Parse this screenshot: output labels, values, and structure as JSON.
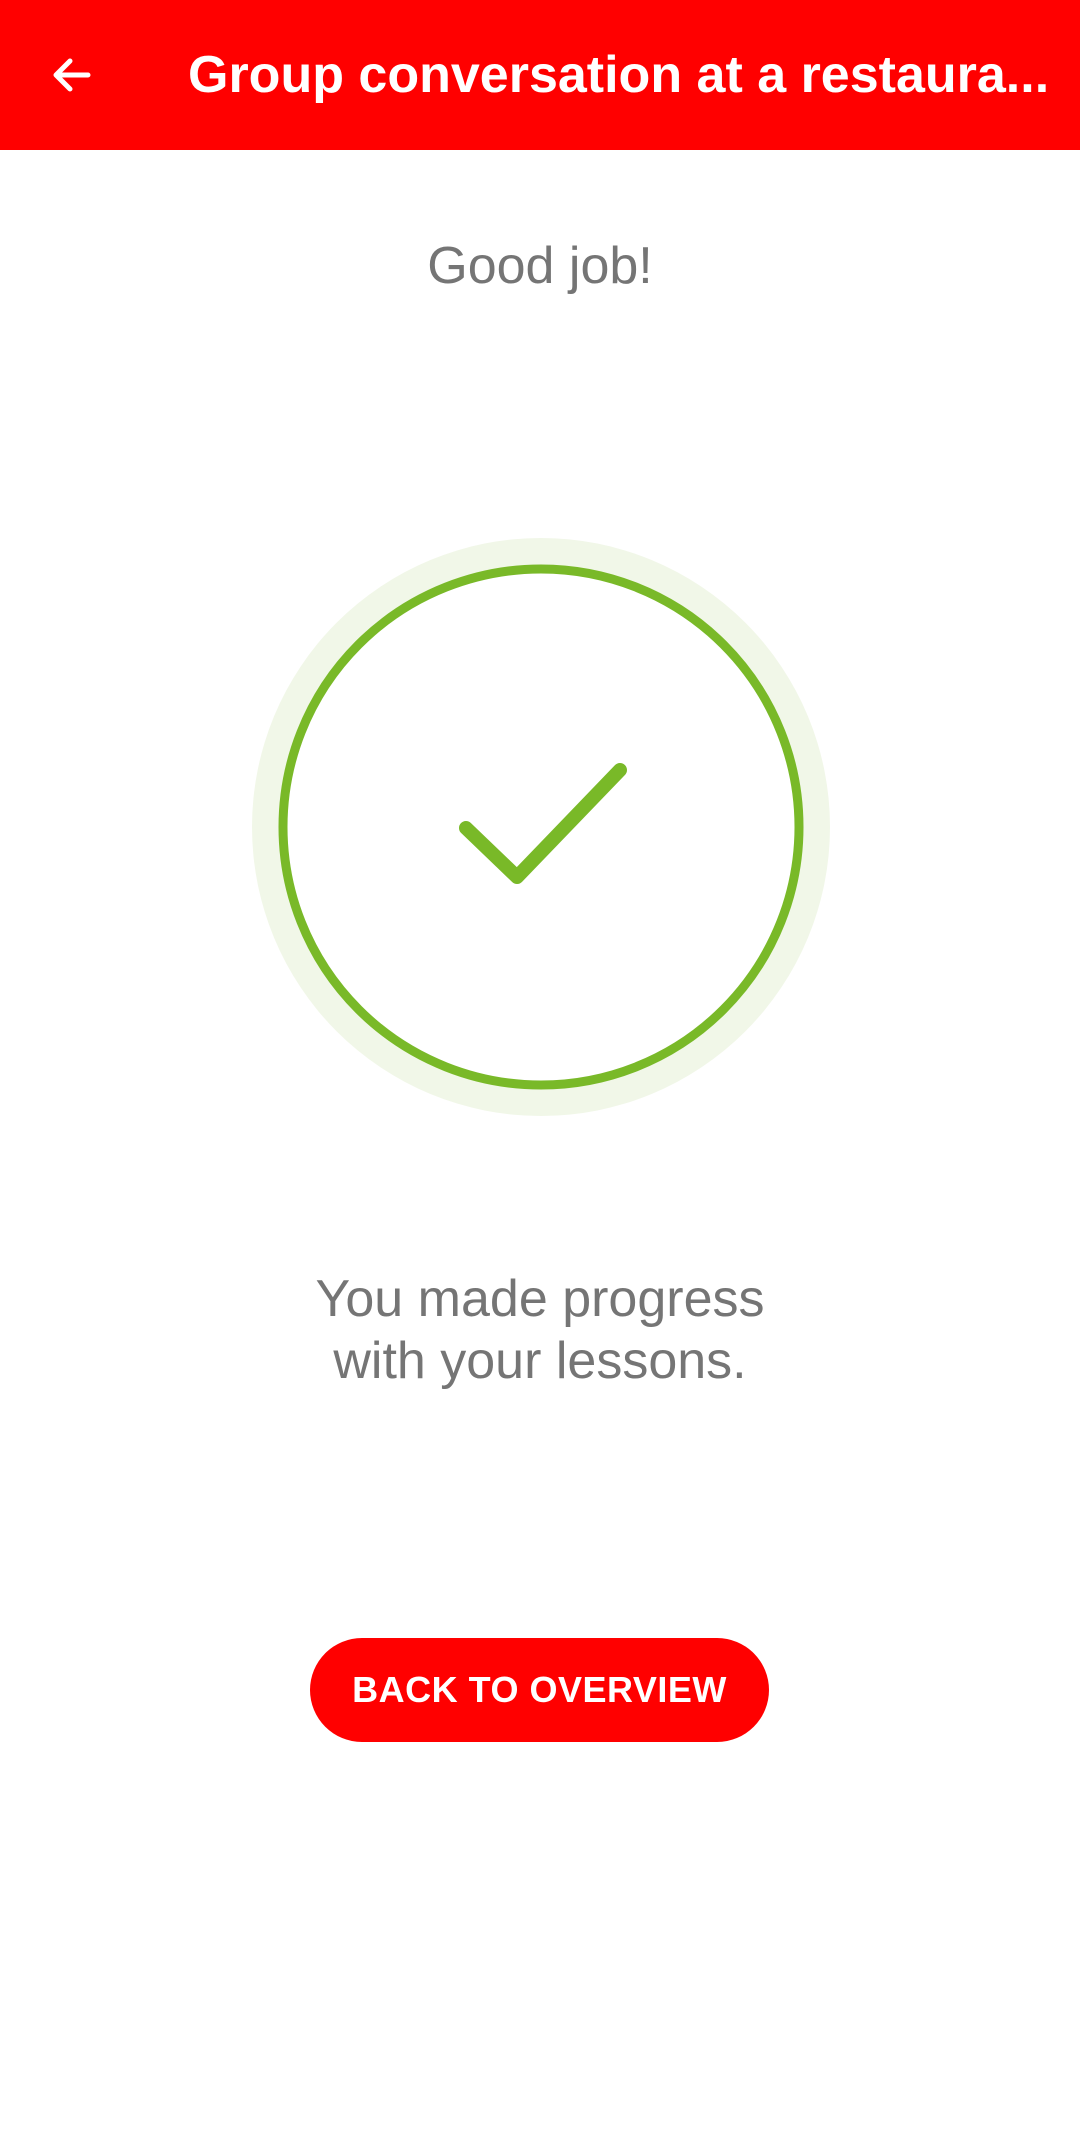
{
  "toolbar": {
    "title": "Group conversation at a restaura...",
    "back_icon": "arrow-left-icon"
  },
  "result": {
    "headline": "Good job!",
    "icon": "checkmark-icon",
    "message_line1": "You made progress",
    "message_line2": "with your lessons."
  },
  "actions": {
    "back_to_overview_label": "BACK TO OVERVIEW"
  },
  "colors": {
    "brand": "#ff0000",
    "success": "#79b928",
    "success_light": "#f1f7e8",
    "text_muted": "#757575"
  }
}
